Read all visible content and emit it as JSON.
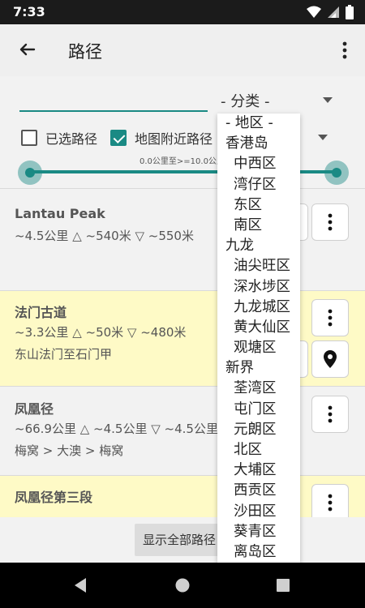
{
  "status_bar": {
    "time": "7:33"
  },
  "app_bar": {
    "title": "路径"
  },
  "filters": {
    "search_value": "",
    "category_selected": "- 分类 -",
    "selected_routes_label": "已选路径",
    "selected_routes_checked": false,
    "nearby_routes_label": "地图附近路径",
    "nearby_routes_checked": true,
    "distance_range_label": "0.0公里至>=10.0公里",
    "distance_range": {
      "min_km": 0.0,
      "max_km": 10.0,
      "low": 0.0,
      "high": 1.0
    }
  },
  "region_dropdown": {
    "options": [
      {
        "label": "- 地区 -",
        "level": 0
      },
      {
        "label": "香港岛",
        "level": 0
      },
      {
        "label": "中西区",
        "level": 1
      },
      {
        "label": "湾仔区",
        "level": 1
      },
      {
        "label": "东区",
        "level": 1
      },
      {
        "label": "南区",
        "level": 1
      },
      {
        "label": "九龙",
        "level": 0
      },
      {
        "label": "油尖旺区",
        "level": 1
      },
      {
        "label": "深水埗区",
        "level": 1
      },
      {
        "label": "九龙城区",
        "level": 1
      },
      {
        "label": "黄大仙区",
        "level": 1
      },
      {
        "label": "观塘区",
        "level": 1
      },
      {
        "label": "新界",
        "level": 0
      },
      {
        "label": "荃湾区",
        "level": 1
      },
      {
        "label": "屯门区",
        "level": 1
      },
      {
        "label": "元朗区",
        "level": 1
      },
      {
        "label": "北区",
        "level": 1
      },
      {
        "label": "大埔区",
        "level": 1
      },
      {
        "label": "西贡区",
        "level": 1
      },
      {
        "label": "沙田区",
        "level": 1
      },
      {
        "label": "葵青区",
        "level": 1
      },
      {
        "label": "离岛区",
        "level": 1
      }
    ]
  },
  "routes": [
    {
      "name": "Lantau Peak",
      "stats": "~4.5公里 △ ~540米 ▽ ~550米",
      "desc": "",
      "highlighted": false
    },
    {
      "name": "法门古道",
      "stats": "~3.3公里 △ ~50米 ▽ ~480米",
      "desc": "东山法门至石门甲",
      "highlighted": true
    },
    {
      "name": "凤凰径",
      "stats": "~66.9公里 △ ~4.5公里 ▽ ~4.5公里",
      "desc": "梅窝 > 大澳 > 梅窝",
      "highlighted": false
    },
    {
      "name": "凤凰径第三段",
      "stats": "",
      "desc": "",
      "highlighted": true
    }
  ],
  "show_all_button": "显示全部路径",
  "icons": {
    "back": "arrow-left-icon",
    "more": "more-vert-icon",
    "location": "map-marker-icon",
    "wifi": "wifi-icon",
    "signal": "signal-icon",
    "battery": "battery-icon"
  },
  "colors": {
    "accent": "#1a8a84",
    "highlight": "#fefac6"
  }
}
